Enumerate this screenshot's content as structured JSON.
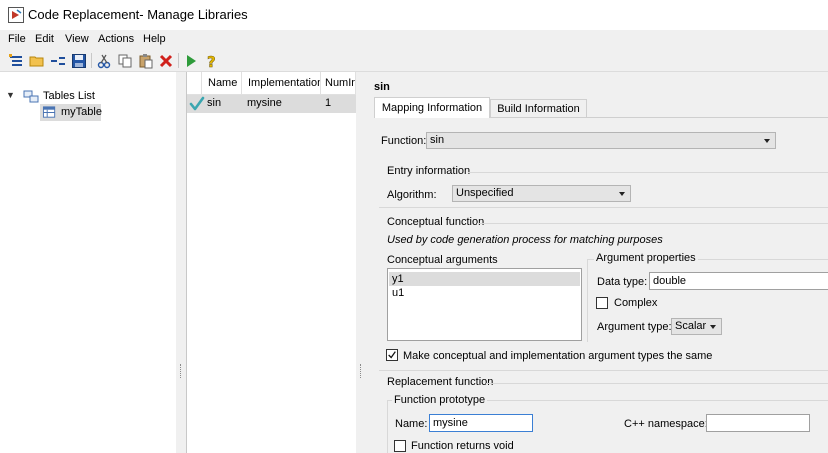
{
  "window": {
    "title": "Code Replacement- Manage Libraries"
  },
  "menu": {
    "items": [
      "File",
      "Edit",
      "View",
      "Actions",
      "Help"
    ]
  },
  "toolbar": {
    "icons": [
      "new-table-icon",
      "open-folder-icon",
      "new-entry-icon",
      "save-icon",
      "cut-icon",
      "copy-icon",
      "paste-icon",
      "delete-icon",
      "run-icon",
      "help-icon"
    ]
  },
  "tree": {
    "root_label": "Tables List",
    "child_label": "myTable"
  },
  "table": {
    "columns": [
      "Name",
      "Implementation",
      "NumIn"
    ],
    "rows": [
      {
        "name": "sin",
        "implementation": "mysine",
        "numin": "1",
        "valid": true
      }
    ]
  },
  "details": {
    "header": "sin",
    "tabs": [
      "Mapping Information",
      "Build Information"
    ],
    "active_tab": "Mapping Information",
    "function_label": "Function:",
    "function_value": "sin",
    "entry_info": {
      "title": "Entry information",
      "algorithm_label": "Algorithm:",
      "algorithm_value": "Unspecified"
    },
    "conceptual": {
      "title": "Conceptual function",
      "description": "Used by code generation process for matching purposes",
      "args_title": "Conceptual arguments",
      "args": [
        "y1",
        "u1"
      ],
      "selected_arg": "y1",
      "props_title": "Argument properties",
      "datatype_label": "Data type:",
      "datatype_value": "double",
      "complex_label": "Complex",
      "complex_checked": false,
      "argtype_label": "Argument type:",
      "argtype_value": "Scalar",
      "same_types_label": "Make conceptual and implementation argument types the same",
      "same_types_checked": true
    },
    "replacement": {
      "title": "Replacement function",
      "prototype_title": "Function prototype",
      "name_label": "Name:",
      "name_value": "mysine",
      "namespace_label": "C++ namespace:",
      "namespace_value": "",
      "returns_void_label": "Function returns void",
      "returns_void_checked": false
    }
  }
}
